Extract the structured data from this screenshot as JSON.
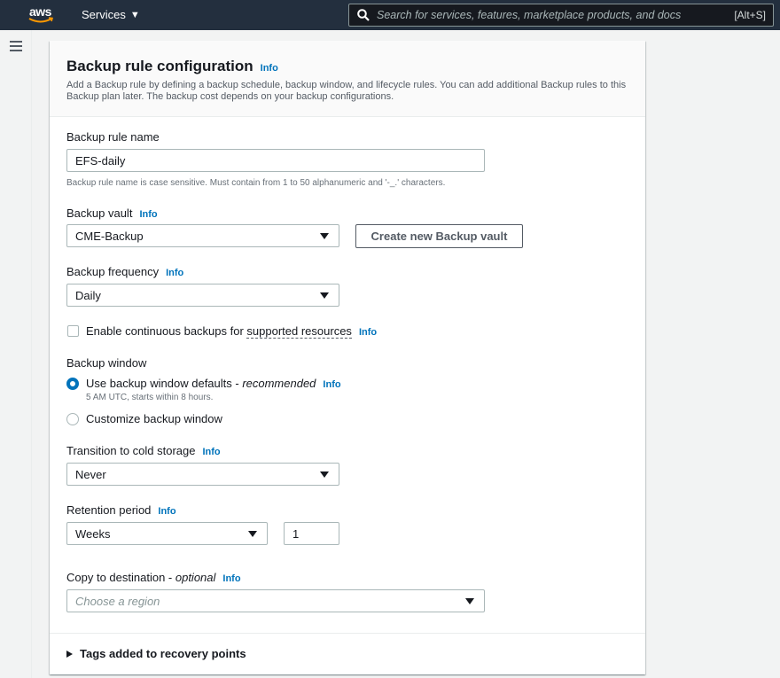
{
  "topnav": {
    "logo_text": "aws",
    "services_label": "Services",
    "services_caret": "▼",
    "search_placeholder": "Search for services, features, marketplace products, and docs",
    "search_shortcut": "[Alt+S]"
  },
  "panel": {
    "title": "Backup rule configuration",
    "title_info": "Info",
    "description": "Add a Backup rule by defining a backup schedule, backup window, and lifecycle rules. You can add additional Backup rules to this Backup plan later. The backup cost depends on your backup configurations."
  },
  "rule_name": {
    "label": "Backup rule name",
    "value": "EFS-daily",
    "hint": "Backup rule name is case sensitive. Must contain from 1 to 50 alphanumeric and '-_.' characters."
  },
  "vault": {
    "label": "Backup vault",
    "info": "Info",
    "selected": "CME-Backup",
    "create_button": "Create new Backup vault"
  },
  "frequency": {
    "label": "Backup frequency",
    "info": "Info",
    "selected": "Daily"
  },
  "continuous": {
    "label_prefix": "Enable continuous backups for",
    "label_link": "supported resources",
    "info": "Info",
    "checked": false
  },
  "window": {
    "label": "Backup window",
    "option1_label": "Use backup window defaults - ",
    "option1_emphasis": "recommended",
    "option1_info": "Info",
    "option1_hint": "5 AM UTC, starts within 8 hours.",
    "option2_label": "Customize backup window",
    "selected": "option1"
  },
  "cold_storage": {
    "label": "Transition to cold storage",
    "info": "Info",
    "selected": "Never"
  },
  "retention": {
    "label": "Retention period",
    "info": "Info",
    "unit": "Weeks",
    "value": "1"
  },
  "copy_destination": {
    "label": "Copy to destination - ",
    "label_optional": "optional",
    "info": "Info",
    "placeholder": "Choose a region"
  },
  "tags": {
    "label": "Tags added to recovery points"
  },
  "colors": {
    "nav_bg": "#232f3e",
    "link": "#0073bb",
    "radio_selected": "#0073bb"
  }
}
